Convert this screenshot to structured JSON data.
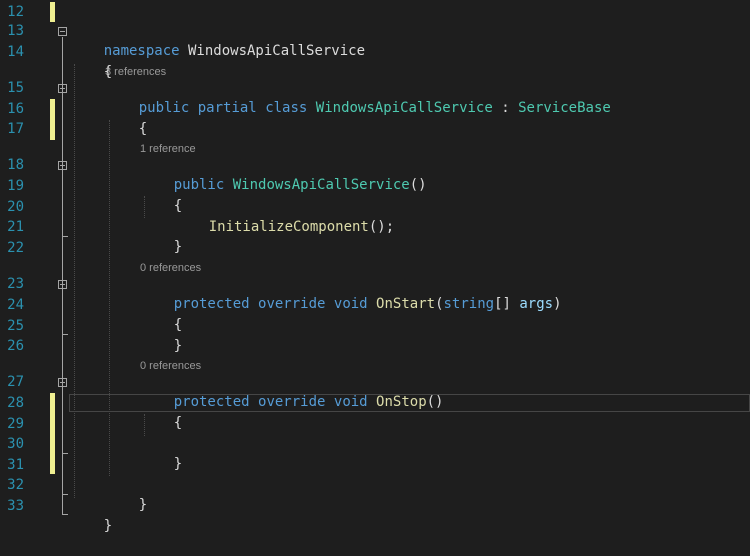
{
  "editor": {
    "line_numbers": [
      "12",
      "13",
      "14",
      "15",
      "16",
      "17",
      "18",
      "19",
      "20",
      "21",
      "22",
      "23",
      "24",
      "25",
      "26",
      "27",
      "28",
      "29",
      "30",
      "31",
      "32",
      "33"
    ],
    "code": {
      "l13_kw": "namespace",
      "l13_name": " WindowsApiCallService",
      "l14_brace": "{",
      "l15_lens": "3 references",
      "l15_public": "public",
      "l15_partial": "partial",
      "l15_class": "class",
      "l15_name": "WindowsApiCallService",
      "l15_colon": " : ",
      "l15_base": "ServiceBase",
      "l16_brace": "{",
      "l18_lens": "1 reference",
      "l18_public": "public",
      "l18_ctor": "WindowsApiCallService",
      "l18_parens": "()",
      "l19_brace": "{",
      "l20_call": "InitializeComponent",
      "l20_tail": "();",
      "l21_brace": "}",
      "l23_lens": "0 references",
      "l23_protected": "protected",
      "l23_override": "override",
      "l23_void": "void",
      "l23_method": "OnStart",
      "l23_open": "(",
      "l23_string": "string",
      "l23_brackets": "[] ",
      "l23_param": "args",
      "l23_close": ")",
      "l24_brace": "{",
      "l25_brace": "}",
      "l27_lens": "0 references",
      "l27_protected": "protected",
      "l27_override": "override",
      "l27_void": "void",
      "l27_method": "OnStop",
      "l27_parens": "()",
      "l28_brace": "{",
      "l30_brace": "}",
      "l32_brace": "}",
      "l33_brace": "}"
    },
    "colors": {
      "background": "#1e1e1e",
      "line_number": "#2b91af",
      "keyword": "#569cd6",
      "type": "#4ec9b0",
      "method": "#dcdcaa",
      "parameter": "#9cdcfe",
      "plain": "#dcdcdc",
      "change_marker": "#efef91",
      "code_lens": "#999999"
    }
  }
}
